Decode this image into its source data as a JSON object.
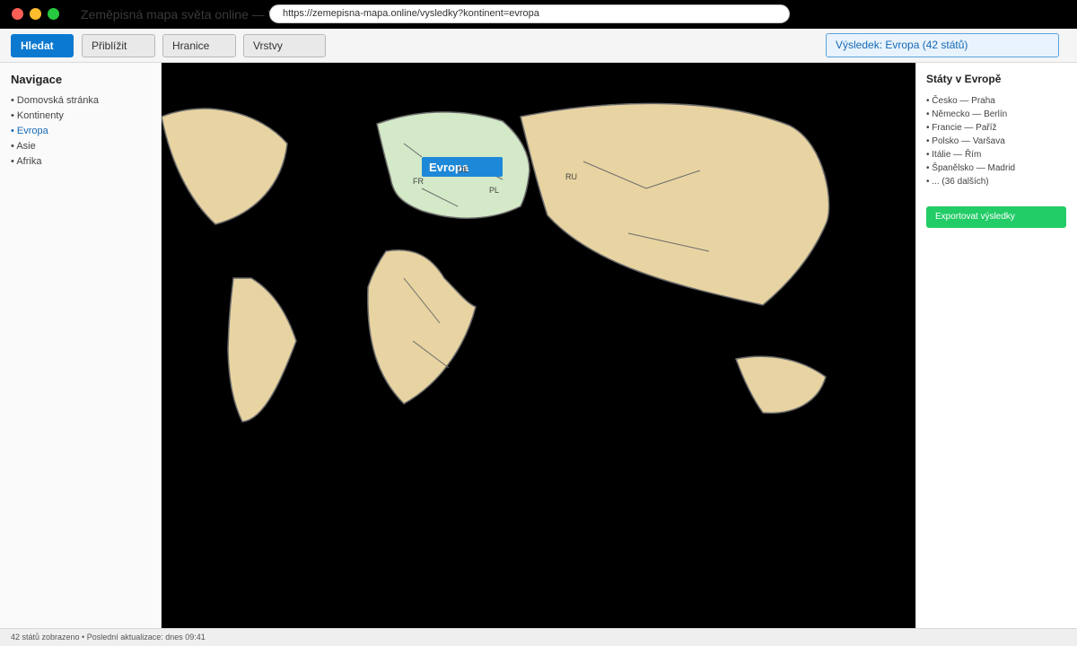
{
  "window": {
    "title": "Zeměpisná mapa světa online — Vý",
    "url": "https://zemepisna-mapa.online/vysledky?kontinent=evropa"
  },
  "toolbar": {
    "buttons": [
      "Hledat",
      "Přiblížit",
      "Hranice",
      "Vrstvy"
    ],
    "result": "Výsledek: Evropa (42 států)"
  },
  "navigation": {
    "title": "Navigace",
    "items": [
      "Domovská stránka",
      "Kontinenty",
      "Evropa",
      "Asie",
      "Afrika"
    ],
    "active_index": 2
  },
  "map": {
    "highlight_label": "Evropa",
    "country_labels": {
      "france": "FR",
      "germany": "DE",
      "poland": "PL",
      "russia": "RU"
    },
    "colors": {
      "background": "#000000",
      "land": "#e8d4a2",
      "highlight": "#d3e9c7",
      "label_bg": "#1e88d8",
      "outline": "#6b6b6b"
    }
  },
  "states": {
    "title": "Státy v Evropě",
    "items": [
      "Česko — Praha",
      "Německo — Berlín",
      "Francie — Paříž",
      "Polsko — Varšava",
      "Itálie — Řím",
      "Španělsko — Madrid",
      "... (36 dalších)"
    ],
    "export_label": "Exportovat výsledky"
  },
  "status": {
    "text": "42 států zobrazeno • Poslední aktualizace: dnes 09:41"
  },
  "colors": {
    "accent": "#0b79d0",
    "export": "#22cc66"
  }
}
